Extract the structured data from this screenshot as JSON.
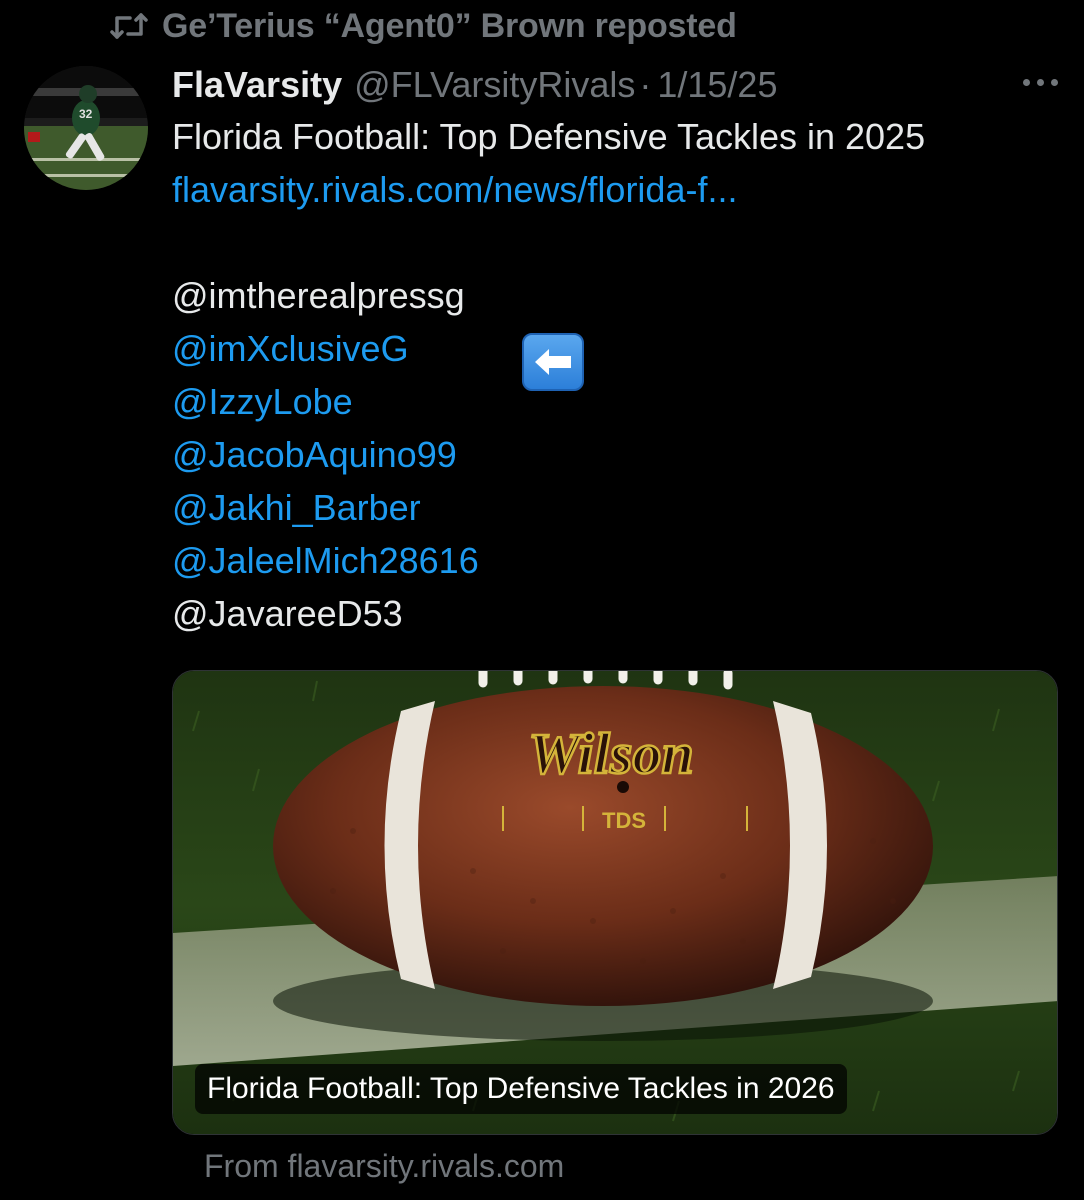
{
  "repost": {
    "icon": "retweet-icon",
    "text": "Ge’Terius “Agent0” Brown reposted"
  },
  "tweet": {
    "display_name": "FlaVarsity",
    "handle": "@FLVarsityRivals",
    "separator": "·",
    "date": "1/15/25",
    "lines": [
      "Florida Football: Top Defensive Tackles in 2025",
      "flavarsity.rivals.com/news/florida-f...",
      "@imtherealpressg",
      "@imXclusiveG",
      "@IzzyLobe",
      "@JacobAquino99",
      "@Jakhi_Barber",
      "@JaleelMich28616",
      "@JavareeD53"
    ],
    "arrow_emoji": "left-arrow-emoji"
  },
  "card": {
    "caption": "Florida Football: Top Defensive Tackles in 2026",
    "source": "From flavarsity.rivals.com",
    "ball_brand": "Wilson",
    "ball_model": "TDS"
  },
  "colors": {
    "background": "#000000",
    "text": "#e7e9ea",
    "muted": "#71767b",
    "link": "#1d9bf0"
  }
}
